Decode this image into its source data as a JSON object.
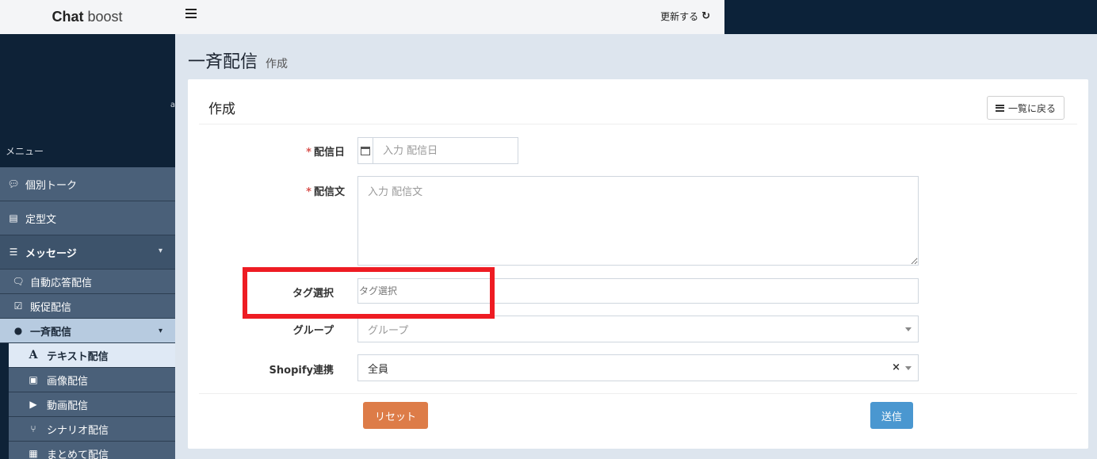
{
  "app": {
    "logo_bold": "Chat",
    "logo_light": "boost"
  },
  "topbar": {
    "refresh_label": "更新する",
    "refresh_icon": "refresh-icon"
  },
  "sidebar": {
    "menu_label": "メニュー",
    "items": [
      {
        "label": "個別トーク",
        "icon": "comment-icon"
      },
      {
        "label": "定型文",
        "icon": "file-icon"
      },
      {
        "label": "メッセージ",
        "icon": "bars-icon"
      }
    ],
    "message_children": [
      {
        "label": "自動応答配信",
        "icon": "comments-icon"
      },
      {
        "label": "販促配信",
        "icon": "calendar-check-icon"
      },
      {
        "label": "一斉配信",
        "icon": "comments-fill-icon"
      }
    ],
    "broadcast_children": [
      {
        "label": "テキスト配信",
        "icon": "font-icon"
      },
      {
        "label": "画像配信",
        "icon": "image-file-icon"
      },
      {
        "label": "動画配信",
        "icon": "video-file-icon"
      },
      {
        "label": "シナリオ配信",
        "icon": "branch-icon"
      },
      {
        "label": "まとめて配信",
        "icon": "list-alt-icon"
      }
    ]
  },
  "page": {
    "title": "一斉配信",
    "subtitle": "作成"
  },
  "card": {
    "title": "作成",
    "back_label": "一覧に戻る"
  },
  "form": {
    "required_mark": "*",
    "date": {
      "label": "配信日",
      "placeholder": "入力 配信日"
    },
    "message": {
      "label": "配信文",
      "placeholder": "入力 配信文"
    },
    "tag": {
      "label": "タグ選択",
      "placeholder": "タグ選択"
    },
    "group": {
      "label": "グループ",
      "placeholder": "グループ"
    },
    "shopify": {
      "label": "Shopify連携",
      "value": "全員",
      "clear": "×"
    }
  },
  "buttons": {
    "reset": "リセット",
    "send": "送信"
  },
  "colors": {
    "highlight": "#ee1c23",
    "reset": "#dd7c48",
    "send": "#4a97d0",
    "sidebar": "#0e2237"
  }
}
